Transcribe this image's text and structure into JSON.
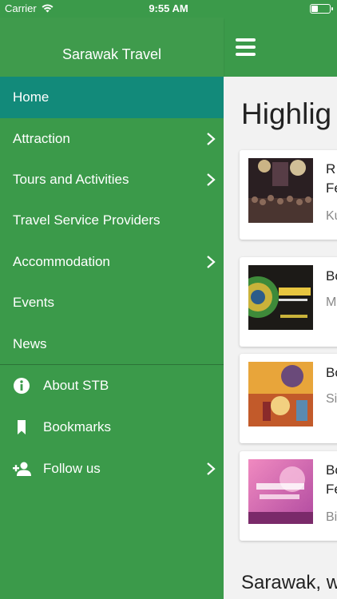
{
  "status_bar": {
    "carrier": "Carrier",
    "time": "9:55 AM"
  },
  "drawer": {
    "title": "Sarawak Travel",
    "items": [
      {
        "label": "Home",
        "active": true,
        "chevron": false
      },
      {
        "label": "Attraction",
        "active": false,
        "chevron": true
      },
      {
        "label": "Tours and Activities",
        "active": false,
        "chevron": true
      },
      {
        "label": "Travel Service Providers",
        "active": false,
        "chevron": false
      },
      {
        "label": "Accommodation",
        "active": false,
        "chevron": true
      },
      {
        "label": "Events",
        "active": false,
        "chevron": false
      },
      {
        "label": "News",
        "active": false,
        "chevron": false
      }
    ],
    "secondary_items": [
      {
        "label": "About STB",
        "icon": "info-icon",
        "chevron": false
      },
      {
        "label": "Bookmarks",
        "icon": "bookmark-icon",
        "chevron": false
      },
      {
        "label": "Follow us",
        "icon": "add-person-icon",
        "chevron": true
      }
    ]
  },
  "main": {
    "heading": "Highlig",
    "cards": [
      {
        "title": "R\nFe",
        "subtitle": "Ku"
      },
      {
        "title": "Bo",
        "subtitle": "M"
      },
      {
        "title": "Bo",
        "subtitle": "Si"
      },
      {
        "title": "Bo\nFe",
        "subtitle": "Bi"
      }
    ],
    "footer_text": "Sarawak, w"
  },
  "colors": {
    "primary": "#3b9a4a",
    "active": "#128a7a"
  }
}
